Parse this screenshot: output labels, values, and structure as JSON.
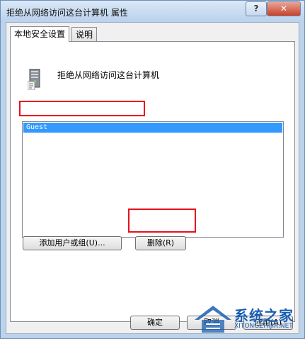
{
  "window": {
    "title": "拒绝从网络访问这台计算机 属性",
    "help_label": "?",
    "close_label": "✕"
  },
  "tabs": [
    {
      "label": "本地安全设置",
      "active": true
    },
    {
      "label": "说明",
      "active": false
    }
  ],
  "policy": {
    "icon": "server-computer-icon",
    "title": "拒绝从网络访问这台计算机"
  },
  "accounts": {
    "items": [
      {
        "label": "Guest",
        "selected": true
      }
    ]
  },
  "buttons": {
    "add_label": "添加用户或组(U)...",
    "remove_label": "删除(R)",
    "ok_label": "确定",
    "cancel_label": "取消",
    "apply_label": "应用(A)"
  },
  "watermark": {
    "brand": "系统之家",
    "url": "XITONGZHIJIA.NET"
  },
  "colors": {
    "selection": "#3399ff",
    "highlight_box": "#e8101d",
    "watermark": "#1b5fb2"
  }
}
